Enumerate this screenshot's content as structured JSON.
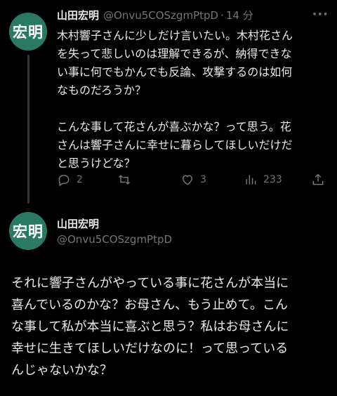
{
  "tweet1": {
    "avatar_text": "宏明",
    "name": "山田宏明",
    "handle": "@Onvu5COSzgmPtpD",
    "separator": "·",
    "time": "14 分",
    "more": "···",
    "lines": [
      "木村響子さんに少しだけ言いたい。木村花さん",
      "を失って悲しいのは理解できるが、納得できな",
      "い事に何でもかんでも反論、攻撃するのは如何",
      "なものだろうか？"
    ],
    "lines2": [
      "こんな事して花さんが喜ぶかな？って思う。花",
      "さんは響子さんに幸せに暮らしてほしいだけだ",
      "と思うけどな？"
    ],
    "actions": {
      "reply_count": "2",
      "retweet_count": "",
      "like_count": "3",
      "views_count": "233"
    }
  },
  "tweet2": {
    "avatar_text": "宏明",
    "name": "山田宏明",
    "handle": "@Onvu5COSzgmPtpD",
    "lines": [
      "それに響子さんがやっている事に花さんが本当に",
      "喜んでいるのかな？お母さん、もう止めて。こん",
      "な事して私が本当に喜ぶと思う？私はお母さんに",
      "幸せに生きてほしいだけなのに！って思っている",
      "んじゃないかな？"
    ]
  },
  "colors": {
    "background": "#000000",
    "text": "#e7e9ea",
    "secondary": "#71767b",
    "avatar": "#2a7a63",
    "thread_line": "#333639"
  }
}
